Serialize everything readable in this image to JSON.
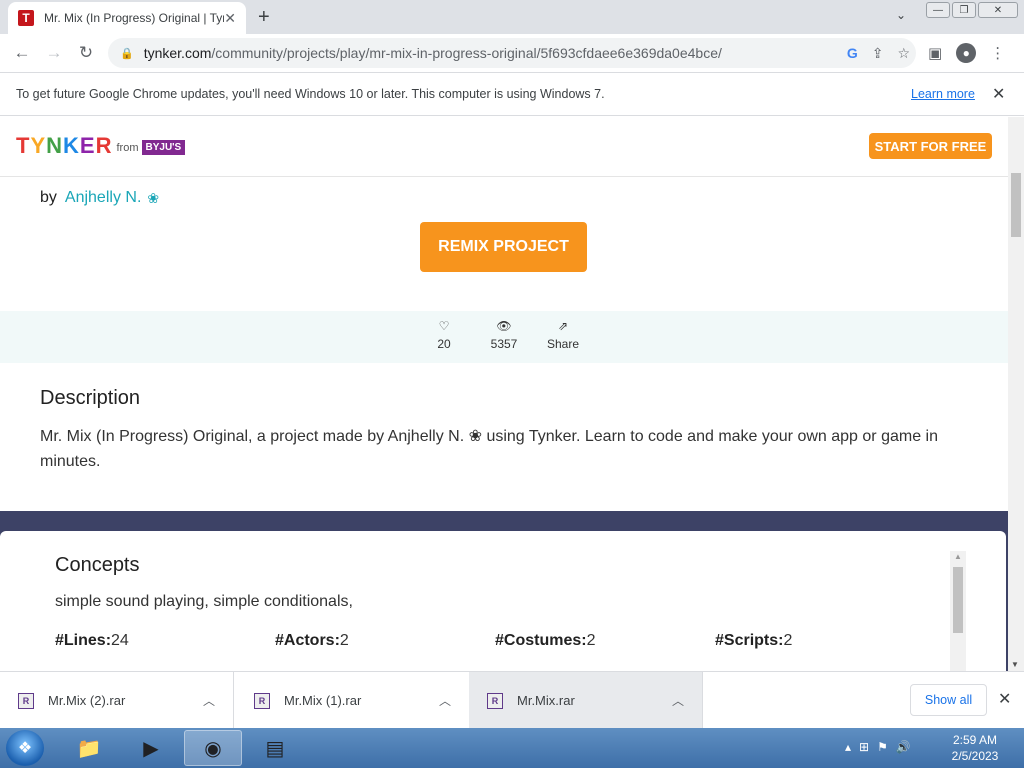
{
  "browser": {
    "tab_title": "Mr. Mix (In Progress) Original | Tynker",
    "tab_favicon_letter": "T",
    "url_host": "tynker.com",
    "url_path": "/community/projects/play/mr-mix-in-progress-original/5f693cfdaee6e369da0e4bce/",
    "google_letter": "G"
  },
  "infobar": {
    "message": "To get future Google Chrome updates, you'll need Windows 10 or later. This computer is using Windows 7.",
    "link": "Learn more"
  },
  "site": {
    "logo_from": "from",
    "logo_byjus": "BYJU'S",
    "start_button": "START FOR FREE"
  },
  "project": {
    "by_label": "by",
    "author": "Anjhelly N.",
    "remix_button": "REMIX PROJECT",
    "likes": "20",
    "views": "5357",
    "share": "Share",
    "description_title": "Description",
    "description": "Mr. Mix (In Progress) Original, a project made by Anjhelly N. ❀ using Tynker. Learn to code and make your own app or game in minutes.",
    "concepts_title": "Concepts",
    "concepts": "simple sound playing, simple conditionals,",
    "metrics": [
      {
        "label": "#Lines:",
        "value": "24"
      },
      {
        "label": "#Actors:",
        "value": "2"
      },
      {
        "label": "#Costumes:",
        "value": "2"
      },
      {
        "label": "#Scripts:",
        "value": "2"
      }
    ]
  },
  "downloads": {
    "items": [
      {
        "name": "Mr.Mix (2).rar"
      },
      {
        "name": "Mr.Mix (1).rar"
      },
      {
        "name": "Mr.Mix.rar"
      }
    ],
    "show_all": "Show all"
  },
  "taskbar": {
    "time": "2:59 AM",
    "date": "2/5/2023"
  },
  "colors": {
    "accent_orange": "#f7941d",
    "author_teal": "#1aa6b7",
    "navy_band": "#3d4266",
    "stats_band": "#f1f9f9"
  },
  "icons": {
    "favicon": "tynker-favicon",
    "like": "heart-icon",
    "views": "eye-icon",
    "share": "share-icon",
    "badge": "badge-icon",
    "archive": "winrar-icon"
  }
}
